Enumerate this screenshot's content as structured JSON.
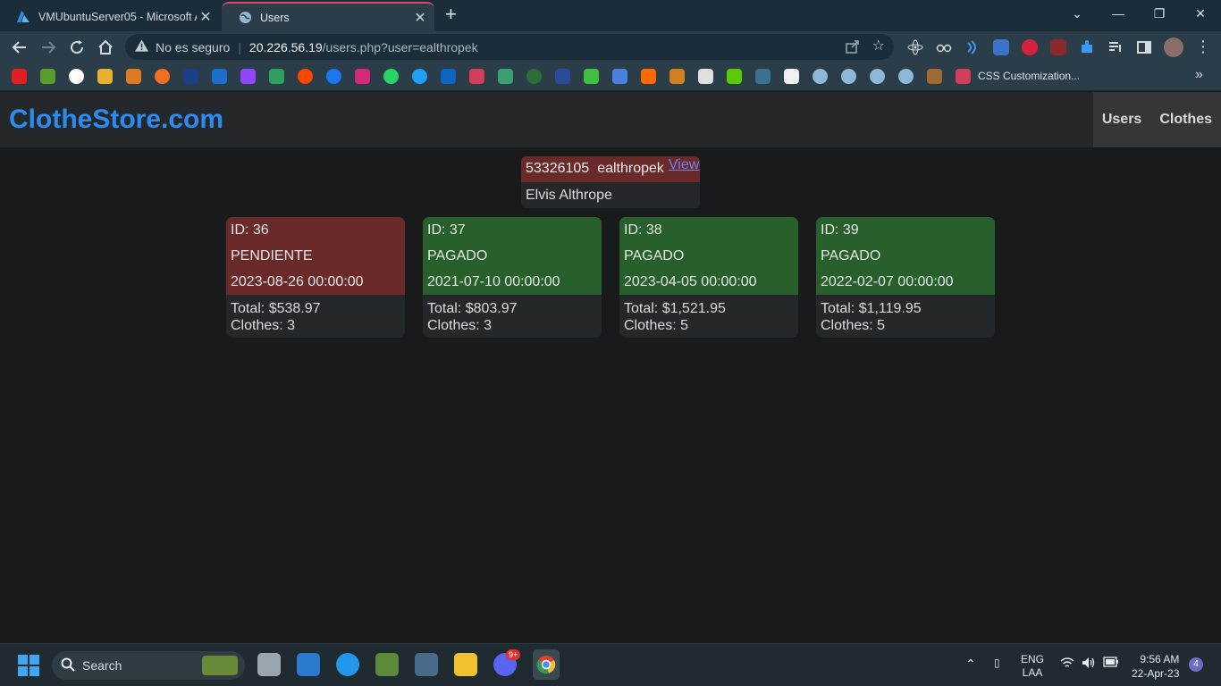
{
  "browser": {
    "tabs": [
      {
        "title": "VMUbuntuServer05 - Microsoft A",
        "icon": "azure-icon",
        "active": false
      },
      {
        "title": "Users",
        "icon": "globe-icon",
        "active": true
      }
    ],
    "address": {
      "security": "No es seguro",
      "host": "20.226.56.19",
      "path": "/users.php?user=ealthropek"
    },
    "bookmarks": {
      "named": "CSS Customization..."
    }
  },
  "site": {
    "brand": "ClotheStore.com",
    "nav": [
      "Users",
      "Clothes"
    ]
  },
  "user": {
    "id": "53326105",
    "username": "ealthropek",
    "view_label": "View",
    "full_name": "Elvis Althrope"
  },
  "orders": [
    {
      "id": "ID: 36",
      "status": "PENDIENTE",
      "date": "2023-08-26 00:00:00",
      "total": "Total: $538.97",
      "clothes": "Clothes: 3",
      "color": "#6a2a2a"
    },
    {
      "id": "ID: 37",
      "status": "PAGADO",
      "date": "2021-07-10 00:00:00",
      "total": "Total: $803.97",
      "clothes": "Clothes: 3",
      "color": "#27602a"
    },
    {
      "id": "ID: 38",
      "status": "PAGADO",
      "date": "2023-04-05 00:00:00",
      "total": "Total: $1,521.95",
      "clothes": "Clothes: 5",
      "color": "#27602a"
    },
    {
      "id": "ID: 39",
      "status": "PAGADO",
      "date": "2022-02-07 00:00:00",
      "total": "Total: $1,119.95",
      "clothes": "Clothes: 5",
      "color": "#27602a"
    }
  ],
  "taskbar": {
    "search": "Search",
    "lang": "ENG",
    "layout": "LAA",
    "time": "9:56 AM",
    "date": "22-Apr-23",
    "notif_count": "4",
    "discord_badge": "9+"
  },
  "colors": {
    "brand": "#2a8cf0",
    "pending": "#6a2a2a",
    "paid": "#27602a",
    "link": "#6b84f6"
  }
}
